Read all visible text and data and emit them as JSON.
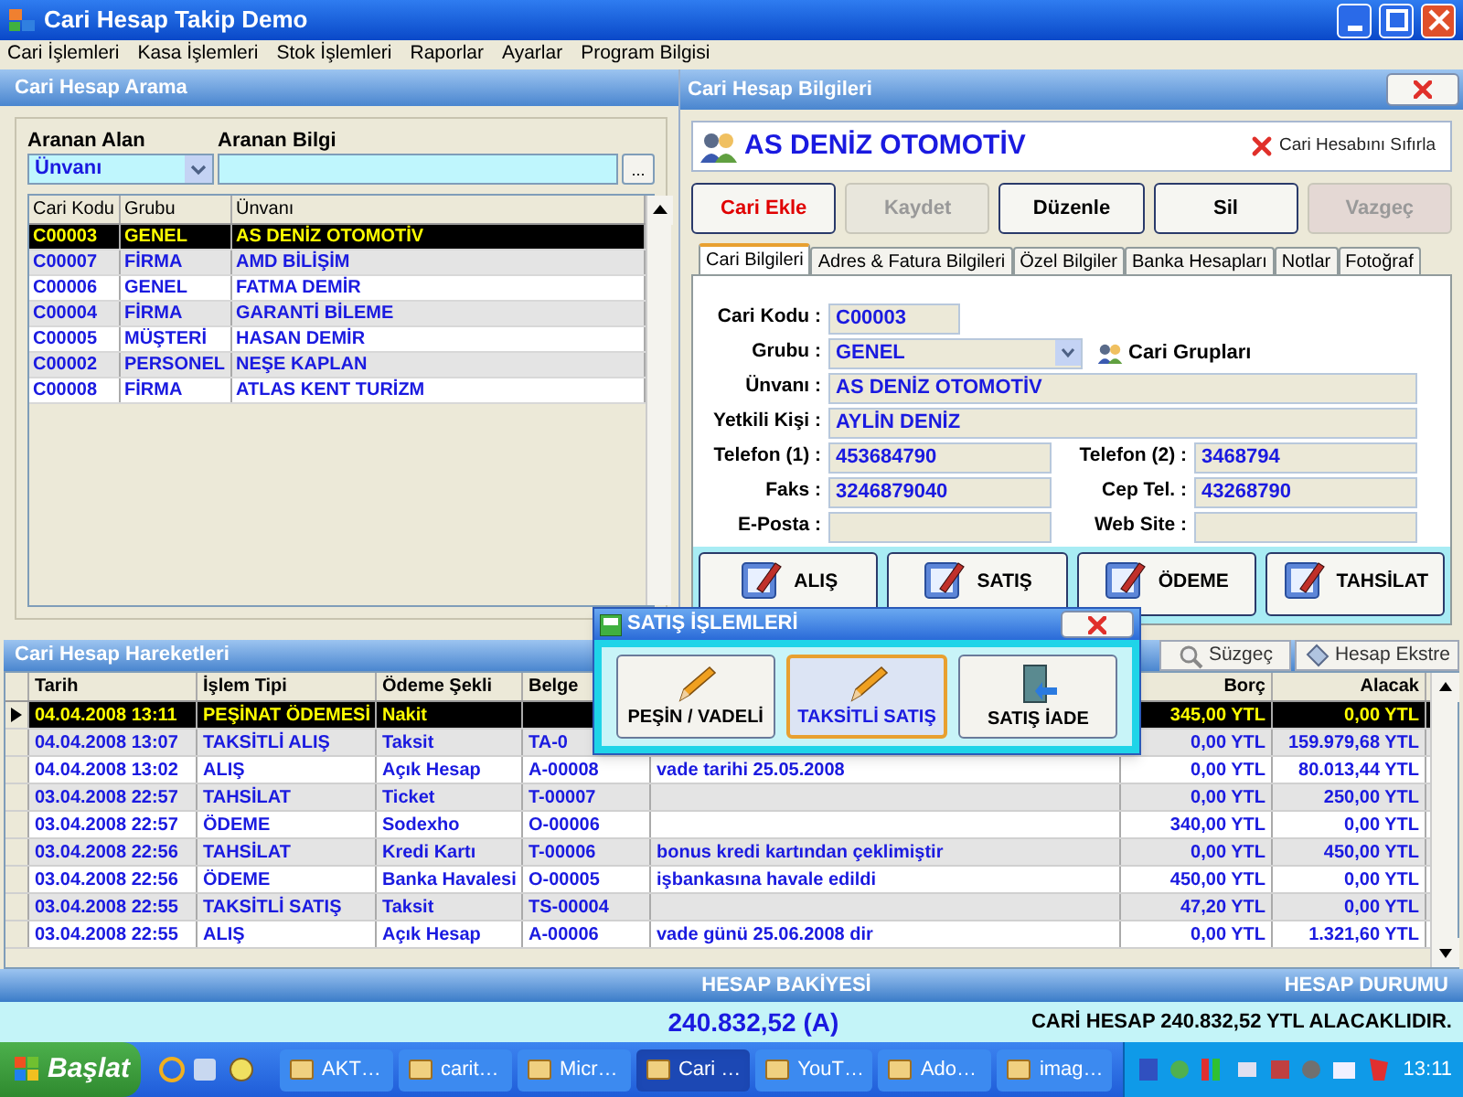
{
  "window": {
    "title": "Cari Hesap Takip Demo"
  },
  "menu": [
    "Cari İşlemleri",
    "Kasa İşlemleri",
    "Stok İşlemleri",
    "Raporlar",
    "Ayarlar",
    "Program Bilgisi"
  ],
  "search_panel": {
    "title": "Cari Hesap Arama",
    "field_label": "Aranan Alan",
    "field_value": "Ünvanı",
    "info_label": "Aranan Bilgi",
    "browse_button": "...",
    "columns": [
      "Cari Kodu",
      "Grubu",
      "Ünvanı"
    ],
    "rows": [
      {
        "cells": [
          "C00003",
          "GENEL",
          "AS DENİZ OTOMOTİV"
        ],
        "selected": true
      },
      {
        "cells": [
          "C00007",
          "FİRMA",
          "AMD BİLİŞİM"
        ],
        "selected": false
      },
      {
        "cells": [
          "C00006",
          "GENEL",
          "FATMA DEMİR"
        ],
        "selected": false
      },
      {
        "cells": [
          "C00004",
          "FİRMA",
          "GARANTİ BİLEME"
        ],
        "selected": false
      },
      {
        "cells": [
          "C00005",
          "MÜŞTERİ",
          "HASAN DEMİR"
        ],
        "selected": false
      },
      {
        "cells": [
          "C00002",
          "PERSONEL",
          "NEŞE KAPLAN"
        ],
        "selected": false
      },
      {
        "cells": [
          "C00008",
          "FİRMA",
          "ATLAS KENT TURİZM"
        ],
        "selected": false
      }
    ]
  },
  "detail_panel": {
    "title": "Cari Hesap Bilgileri",
    "account_name": "AS DENİZ OTOMOTİV",
    "reset_link": "Cari Hesabını Sıfırla",
    "buttons": [
      {
        "label": "Cari Ekle",
        "kind": "add",
        "disabled": false
      },
      {
        "label": "Kaydet",
        "kind": "normal",
        "disabled": true
      },
      {
        "label": "Düzenle",
        "kind": "normal",
        "disabled": false
      },
      {
        "label": "Sil",
        "kind": "normal",
        "disabled": false
      },
      {
        "label": "Vazgeç",
        "kind": "cancel",
        "disabled": true
      }
    ],
    "tabs": [
      {
        "label": "Cari Bilgileri",
        "selected": true
      },
      {
        "label": "Adres & Fatura Bilgileri",
        "selected": false
      },
      {
        "label": "Özel Bilgiler",
        "selected": false
      },
      {
        "label": "Banka Hesapları",
        "selected": false
      },
      {
        "label": "Notlar",
        "selected": false
      },
      {
        "label": "Fotoğraf",
        "selected": false
      }
    ],
    "fields": [
      {
        "label": "Cari Kodu :",
        "value": "C00003",
        "kind": "short"
      },
      {
        "label": "Grubu :",
        "value": "GENEL",
        "kind": "select"
      },
      {
        "label": "Ünvanı :",
        "value": "AS DENİZ OTOMOTİV",
        "kind": "wide"
      },
      {
        "label": "Yetkili Kişi :",
        "value": "AYLİN DENİZ",
        "kind": "wide"
      },
      {
        "label": "Telefon (1) :",
        "value": "453684790",
        "kind": "half"
      },
      {
        "label": "Telefon (2) :",
        "value": "3468794",
        "kind": "half"
      },
      {
        "label": "Faks :",
        "value": "3246879040",
        "kind": "half"
      },
      {
        "label": "Cep Tel. :",
        "value": "43268790",
        "kind": "half"
      },
      {
        "label": "E-Posta :",
        "kind": "half"
      },
      {
        "label": "Web Site :",
        "kind": "half"
      }
    ],
    "group_link": "Cari Grupları",
    "action_buttons": [
      "ALIŞ",
      "SATIŞ",
      "ÖDEME",
      "TAHSİLAT"
    ]
  },
  "movements": {
    "title": "Cari Hesap Hareketleri",
    "tools": [
      "Süzgeç",
      "Hesap Ekstre"
    ],
    "columns": {
      "date": "Tarih",
      "type": "İşlem Tipi",
      "payment": "Ödeme Şekli",
      "document": "Belge",
      "debit": "Borç",
      "credit": "Alacak"
    },
    "rows": [
      {
        "date": "04.04.2008 13:11",
        "type": "PEŞİNAT ÖDEMESİ",
        "payment": "Nakit",
        "debit": "345,00 YTL",
        "credit": "0,00 YTL",
        "selected": true
      },
      {
        "date": "04.04.2008 13:07",
        "type": "TAKSİTLİ ALIŞ",
        "payment": "Taksit",
        "document": "TA-0",
        "debit": "0,00 YTL",
        "credit": "159.979,68 YTL",
        "selected": false
      },
      {
        "date": "04.04.2008 13:02",
        "type": "ALIŞ",
        "payment": "Açık Hesap",
        "document": "A-00008",
        "column_5": "vade tarihi 25.05.2008",
        "debit": "0,00 YTL",
        "credit": "80.013,44 YTL",
        "selected": false
      },
      {
        "date": "03.04.2008 22:57",
        "type": "TAHSİLAT",
        "payment": "Ticket",
        "document": "T-00007",
        "debit": "0,00 YTL",
        "credit": "250,00 YTL",
        "selected": false
      },
      {
        "date": "03.04.2008 22:57",
        "type": "ÖDEME",
        "payment": "Sodexho",
        "document": "O-00006",
        "debit": "340,00 YTL",
        "credit": "0,00 YTL",
        "selected": false
      },
      {
        "date": "03.04.2008 22:56",
        "type": "TAHSİLAT",
        "payment": "Kredi Kartı",
        "document": "T-00006",
        "column_5": "bonus kredi kartından çeklimiştir",
        "debit": "0,00 YTL",
        "credit": "450,00 YTL",
        "selected": false
      },
      {
        "date": "03.04.2008 22:56",
        "type": "ÖDEME",
        "payment": "Banka Havalesi",
        "document": "O-00005",
        "column_5": "işbankasına havale edildi",
        "debit": "450,00 YTL",
        "credit": "0,00 YTL",
        "selected": false
      },
      {
        "date": "03.04.2008 22:55",
        "type": "TAKSİTLİ SATIŞ",
        "payment": "Taksit",
        "document": "TS-00004",
        "debit": "47,20 YTL",
        "credit": "0,00 YTL",
        "selected": false
      },
      {
        "date": "03.04.2008 22:55",
        "type": "ALIŞ",
        "payment": "Açık Hesap",
        "document": "A-00006",
        "column_5": "vade günü 25.06.2008 dir",
        "debit": "0,00 YTL",
        "credit": "1.321,60 YTL",
        "selected": false
      }
    ]
  },
  "summary": {
    "balance_label": "HESAP BAKİYESİ",
    "status_label": "HESAP DURUMU",
    "balance": "240.832,52 (A)",
    "status": "CARİ HESAP 240.832,52 YTL ALACAKLIDIR."
  },
  "dialog": {
    "title": "SATIŞ İŞLEMLERİ",
    "buttons": [
      {
        "label": "PEŞİN / VADELİ",
        "kind": "pencil",
        "selected": false
      },
      {
        "label": "TAKSİTLİ SATIŞ",
        "kind": "pencil",
        "selected": true
      },
      {
        "label": "SATIŞ İADE",
        "kind": "return",
        "selected": false
      }
    ]
  },
  "taskbar": {
    "start": "Başlat",
    "tasks": [
      {
        "label": "AKT…",
        "selected": false
      },
      {
        "label": "carit…",
        "selected": false
      },
      {
        "label": "Micr…",
        "selected": false
      },
      {
        "label": "Cari …",
        "selected": true
      },
      {
        "label": "YouT…",
        "selected": false
      },
      {
        "label": "Ado…",
        "selected": false
      },
      {
        "label": "imag…",
        "selected": false
      }
    ],
    "clock": "13:11"
  }
}
